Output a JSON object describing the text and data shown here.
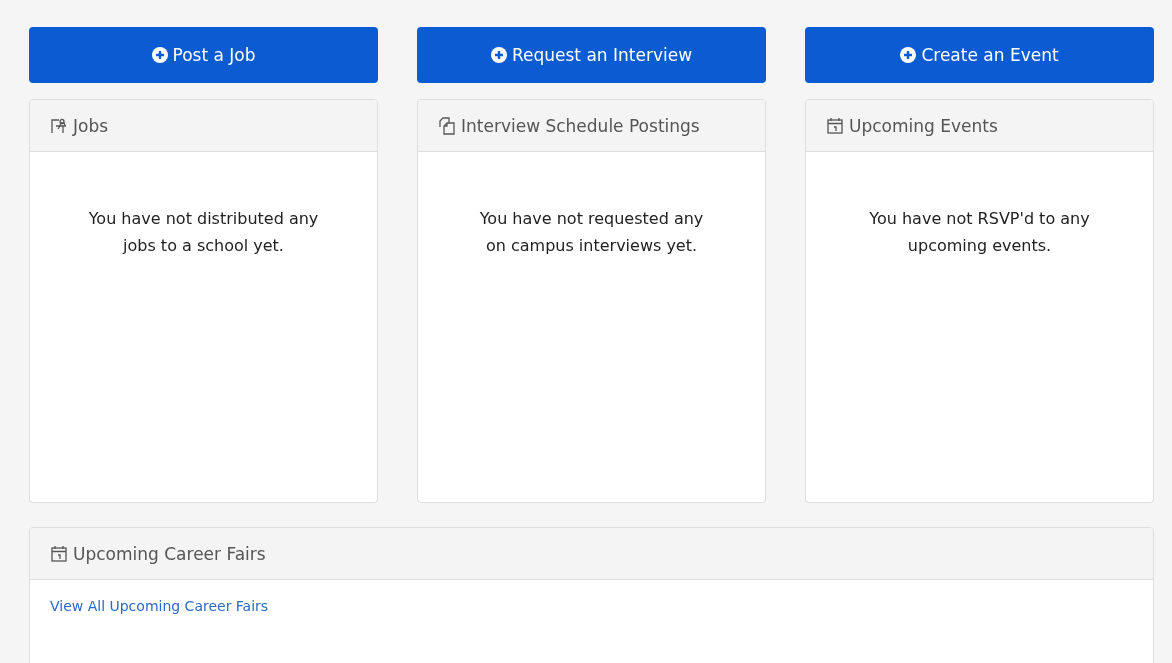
{
  "actions": [
    {
      "label": "Post a Job"
    },
    {
      "label": "Request an Interview"
    },
    {
      "label": "Create an Event"
    }
  ],
  "panels": [
    {
      "title": "Jobs",
      "message": "You have not distributed any jobs to a school yet."
    },
    {
      "title": "Interview Schedule Postings",
      "message": "You have not requested any on campus interviews yet."
    },
    {
      "title": "Upcoming Events",
      "message": "You have not RSVP'd to any upcoming events."
    }
  ],
  "career_fairs": {
    "title": "Upcoming Career Fairs",
    "link": "View All Upcoming Career Fairs"
  }
}
